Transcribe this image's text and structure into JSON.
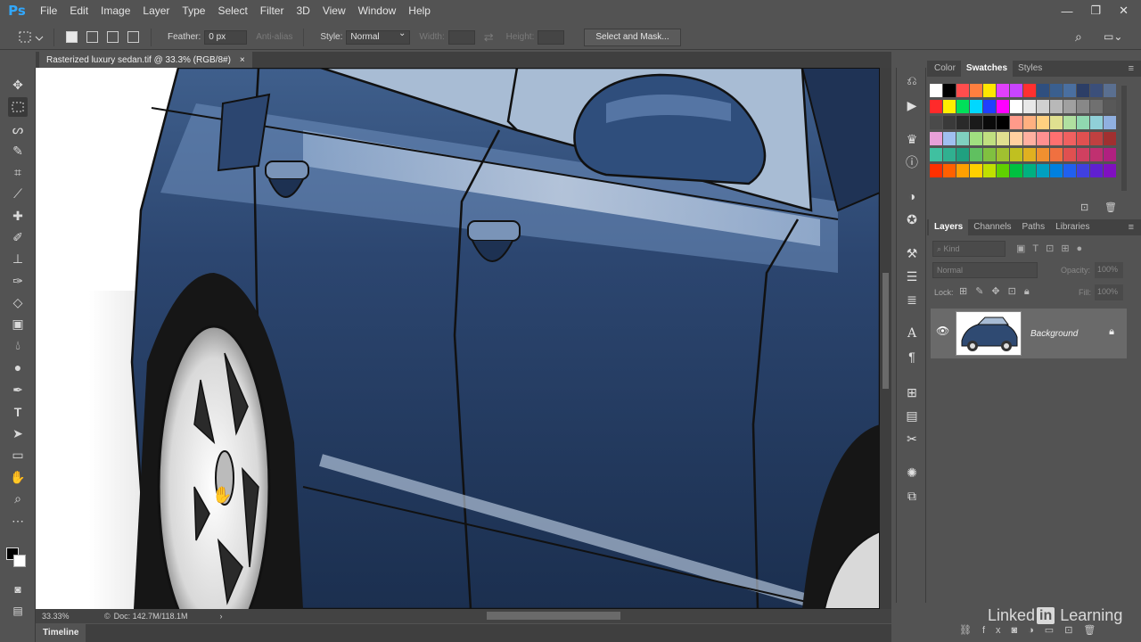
{
  "app": {
    "logo": "Ps"
  },
  "menu": [
    "File",
    "Edit",
    "Image",
    "Layer",
    "Type",
    "Select",
    "Filter",
    "3D",
    "View",
    "Window",
    "Help"
  ],
  "window_controls": {
    "minimize": "—",
    "restore": "❐",
    "close": "✕"
  },
  "options": {
    "feather_label": "Feather:",
    "feather_value": "0 px",
    "antialias_label": "Anti-alias",
    "style_label": "Style:",
    "style_value": "Normal",
    "width_label": "Width:",
    "height_label": "Height:",
    "select_mask_button": "Select and Mask..."
  },
  "document_tab": {
    "title": "Rasterized luxury sedan.tif @ 33.3% (RGB/8#)",
    "close": "×"
  },
  "status": {
    "zoom": "33.33%",
    "doc": "Doc: 142.7M/118.1M"
  },
  "timeline_tab": "Timeline",
  "panels": {
    "top_tabs": [
      "Color",
      "Swatches",
      "Styles"
    ],
    "top_active": "Swatches",
    "layer_tabs": [
      "Layers",
      "Channels",
      "Paths",
      "Libraries"
    ],
    "layer_active": "Layers",
    "kind_filter": "Kind",
    "blend_mode": "Normal",
    "opacity_label": "Opacity:",
    "opacity_value": "100%",
    "lock_label": "Lock:",
    "fill_label": "Fill:",
    "fill_value": "100%",
    "layers": [
      {
        "name": "Background",
        "visible": true,
        "locked": true
      }
    ]
  },
  "swatches": [
    [
      "#ffffff",
      "#000000",
      "#ff4d4d",
      "#ff7f3f",
      "#ffe600",
      "#e040fb",
      "#c844ff",
      "#ff3030",
      "#2f4f7f",
      "#3a5f8f",
      "#4a6fa0",
      "#2c3e66",
      "#3b4f7a",
      "#5a6f90"
    ],
    [
      "#ff2a2a",
      "#ffee00",
      "#00e05a",
      "#00d8ff",
      "#1f3fff",
      "#ff00ff",
      "#ffffff",
      "#e8e8e8",
      "#d0d0d0",
      "#b8b8b8",
      "#a0a0a0",
      "#888888",
      "#707070",
      "#585858"
    ],
    [
      "#4a4a4a",
      "#3a3a3a",
      "#2a2a2a",
      "#1a1a1a",
      "#0a0a0a",
      "#000000",
      "#ff9a8a",
      "#ffb080",
      "#ffd080",
      "#e0e090",
      "#b0e0a0",
      "#90d8b0",
      "#90d0d8",
      "#90b0e0"
    ],
    [
      "#e8a0d8",
      "#a0c0f0",
      "#80d0c0",
      "#a0e080",
      "#c0e080",
      "#e0e090",
      "#ffd0a0",
      "#ffb0a0",
      "#ff9090",
      "#ff7070",
      "#f06060",
      "#e05050",
      "#c04040",
      "#a03030"
    ],
    [
      "#40c0a0",
      "#30b090",
      "#20a080",
      "#60c060",
      "#80c040",
      "#a0c030",
      "#c0c020",
      "#e0b020",
      "#f09030",
      "#f07040",
      "#e05050",
      "#d04060",
      "#c03070",
      "#b02080"
    ],
    [
      "#ff3000",
      "#ff6000",
      "#ffa000",
      "#ffd000",
      "#c0e000",
      "#60d000",
      "#00c040",
      "#00b080",
      "#00a0c0",
      "#0080e0",
      "#2060f0",
      "#4040e0",
      "#6020d0",
      "#8010c0"
    ]
  ],
  "colors": {
    "ui_bg": "#535353",
    "dark": "#3f3f3f",
    "accent": "#31a8ff",
    "car_body": "#2f4a72"
  },
  "watermark": {
    "brand": "Linked",
    "in": "in",
    "suffix": "Learning"
  }
}
